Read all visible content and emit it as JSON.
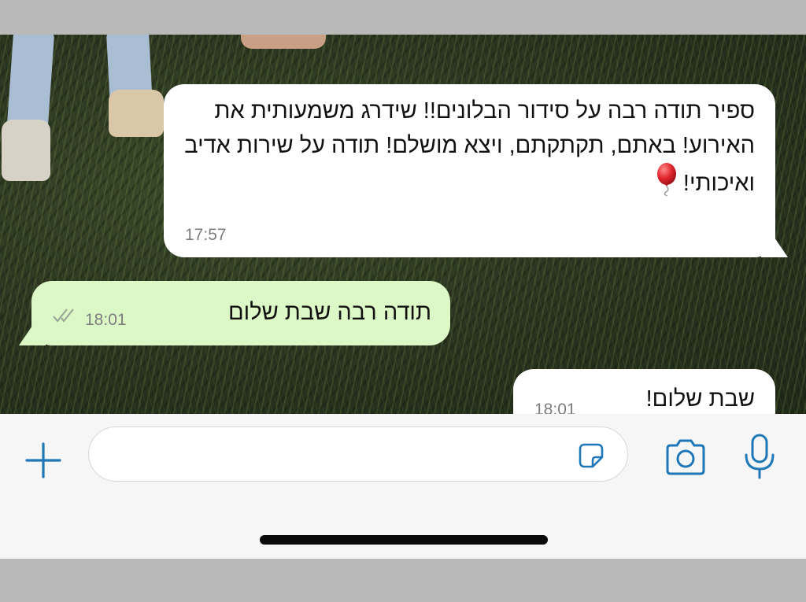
{
  "chat": {
    "messages": [
      {
        "direction": "incoming",
        "text": "ספיר תודה רבה על סידור הבלונים!! שידרג משמעותית את האירוע! באתם, תקתקתם, ויצא מושלם! תודה על שירות אדיב ואיכותי!",
        "emoji": "balloon-icon",
        "time": "17:57"
      },
      {
        "direction": "outgoing",
        "text": "תודה רבה שבת שלום",
        "time": "18:01",
        "status": "double-check-icon"
      },
      {
        "direction": "incoming",
        "text": "שבת שלום!",
        "time": "18:01"
      }
    ]
  },
  "composer": {
    "input_value": "",
    "icons": {
      "attach": "plus-icon",
      "sticker": "sticker-icon",
      "camera": "camera-icon",
      "voice": "microphone-icon"
    }
  },
  "colors": {
    "accent": "#1e78b8",
    "incoming_bubble": "#ffffff",
    "outgoing_bubble": "#dcf8c6"
  }
}
